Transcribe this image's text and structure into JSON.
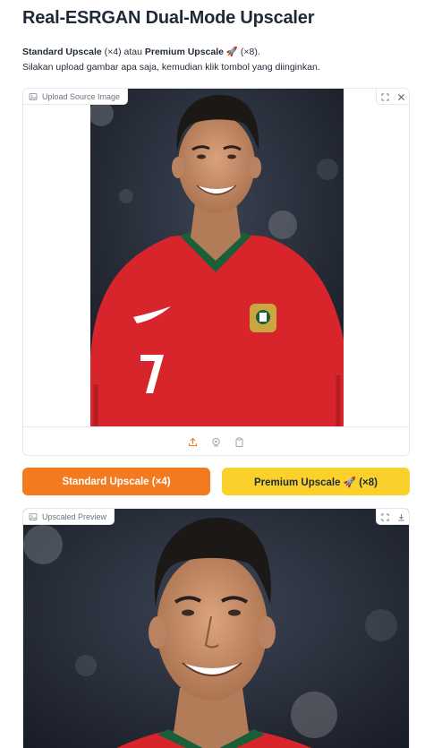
{
  "title": "Real-ESRGAN Dual-Mode Upscaler",
  "description": {
    "standard_bold": "Standard Upscale",
    "standard_suffix": " (×4) atau ",
    "premium_bold": "Premium Upscale",
    "premium_suffix": " 🚀 (×8).",
    "line2": "Silakan upload gambar apa saja, kemudian klik tombol yang diinginkan."
  },
  "source_panel": {
    "label": "Upload Source Image",
    "icons": [
      "fullscreen-icon",
      "close-icon",
      "upload-icon",
      "webcam-icon",
      "clipboard-icon"
    ]
  },
  "buttons": {
    "standard": "Standard Upscale (×4)",
    "premium": "Premium Upscale 🚀 (×8)"
  },
  "output_panel": {
    "label": "Upscaled Preview",
    "icons": [
      "fullscreen-icon",
      "download-icon"
    ]
  },
  "colors": {
    "standard_button": "#f47a1f",
    "premium_button": "#fad12a",
    "jersey_red": "#d7252b"
  }
}
